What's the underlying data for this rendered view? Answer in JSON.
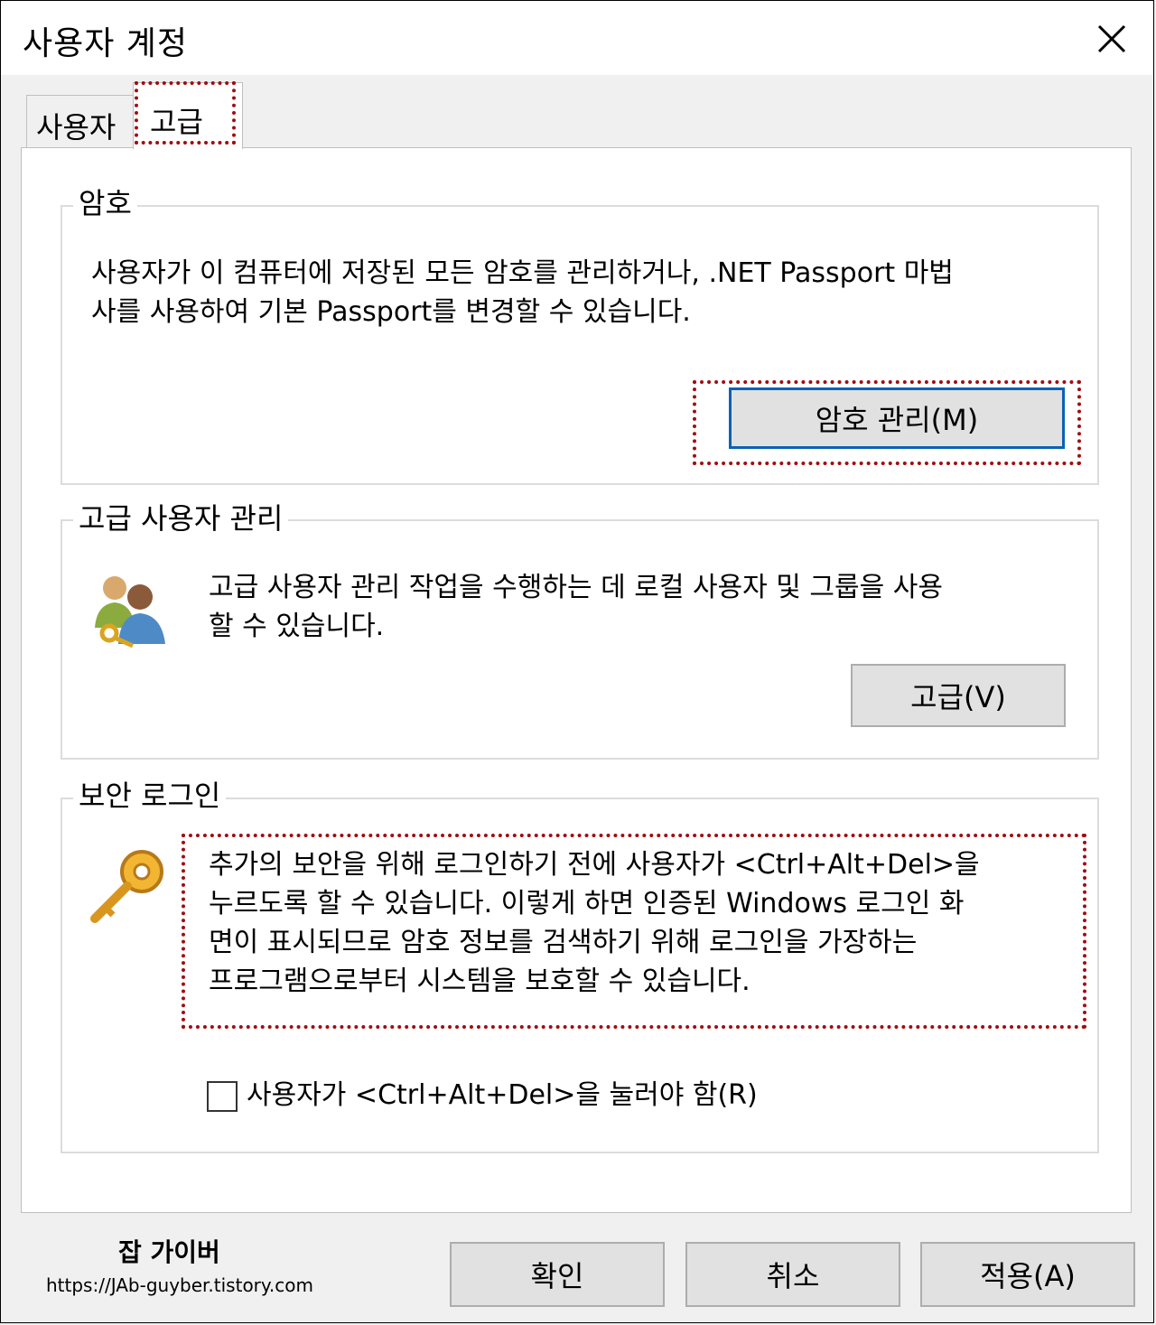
{
  "window": {
    "title": "사용자 계정"
  },
  "tabs": [
    {
      "label": "사용자"
    },
    {
      "label": "고급"
    }
  ],
  "password_group": {
    "title": "암호",
    "line1": "사용자가 이 컴퓨터에 저장된 모든 암호를 관리하거나, .NET Passport 마법",
    "line2": "사를 사용하여 기본 Passport를 변경할 수 있습니다.",
    "button": "암호 관리(M)"
  },
  "advanced_group": {
    "title": "고급 사용자 관리",
    "line1": "고급 사용자 관리 작업을 수행하는 데 로컬 사용자 및 그룹을 사용",
    "line2": "할 수 있습니다.",
    "button": "고급(V)",
    "icon": "users-key-icon"
  },
  "secure_group": {
    "title": "보안 로그인",
    "line1": "추가의 보안을 위해 로그인하기 전에 사용자가 <Ctrl+Alt+Del>을",
    "line2": "누르도록 할 수 있습니다. 이렇게 하면 인증된 Windows 로그인 화",
    "line3": "면이 표시되므로 암호 정보를 검색하기 위해 로그인을 가장하는",
    "line4": "프로그램으로부터 시스템을 보호할 수 있습니다.",
    "checkbox_label": "사용자가 <Ctrl+Alt+Del>을 눌러야 함(R)",
    "checkbox_checked": false,
    "icon": "key-icon"
  },
  "footer": {
    "ok": "확인",
    "cancel": "취소",
    "apply": "적용(A)"
  },
  "watermark": {
    "name": "잡 가이버",
    "url": "https://JAb-guyber.tistory.com"
  },
  "colors": {
    "highlight": "#a00d12",
    "focus_border": "#0a62b5",
    "button_bg": "#e1e1e1"
  }
}
